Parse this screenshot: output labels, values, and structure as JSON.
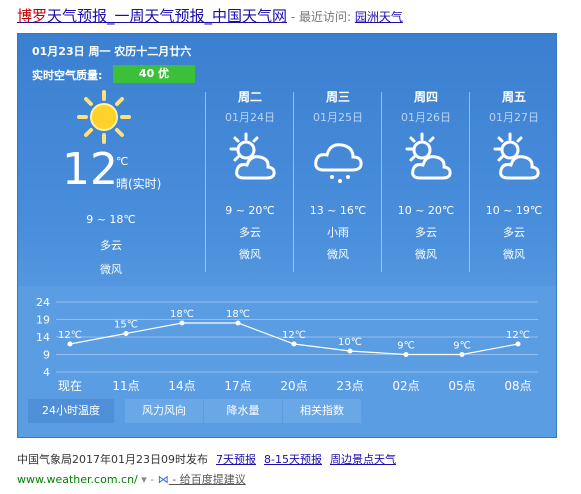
{
  "header": {
    "title_highlight": "博罗",
    "title_rest": "天气预报_一周天气预报_中国天气网",
    "recent_label": " - 最近访问: ",
    "recent_link": "园洲天气"
  },
  "today": {
    "date": "01月23日 周一  农历十二月廿六",
    "aqi_label": "实时空气质量:",
    "aqi_value": "40 优",
    "temp": "12",
    "unit": "℃",
    "note": "晴(实时)",
    "range": "9 ~ 18℃",
    "condition": "多云",
    "wind": "微风",
    "icon": "sun-icon"
  },
  "forecast": [
    {
      "weekday": "周二",
      "date": "01月24日",
      "range": "9 ~ 20℃",
      "condition": "多云",
      "wind": "微风",
      "icon": "partly-cloudy-icon"
    },
    {
      "weekday": "周三",
      "date": "01月25日",
      "range": "13 ~ 16℃",
      "condition": "小雨",
      "wind": "微风",
      "icon": "light-rain-icon"
    },
    {
      "weekday": "周四",
      "date": "01月26日",
      "range": "10 ~ 20℃",
      "condition": "多云",
      "wind": "微风",
      "icon": "partly-cloudy-icon"
    },
    {
      "weekday": "周五",
      "date": "01月27日",
      "range": "10 ~ 19℃",
      "condition": "多云",
      "wind": "微风",
      "icon": "partly-cloudy-icon"
    }
  ],
  "chart_data": {
    "type": "line",
    "categories": [
      "现在",
      "11点",
      "14点",
      "17点",
      "20点",
      "23点",
      "02点",
      "05点",
      "08点"
    ],
    "values": [
      12,
      15,
      18,
      18,
      12,
      10,
      9,
      9,
      12
    ],
    "point_labels": [
      "12℃",
      "15℃",
      "18℃",
      "18℃",
      "12℃",
      "10℃",
      "9℃",
      "9℃",
      "12℃"
    ],
    "y_ticks": [
      "24",
      "19",
      "14",
      "9",
      "4"
    ],
    "ylim": [
      4,
      24
    ],
    "grid": true
  },
  "tabs": [
    "24小时温度",
    "风力风向",
    "降水量",
    "相关指数"
  ],
  "footer": {
    "publish": "中国气象局2017年01月23日09时发布",
    "links": [
      "7天预报",
      "8-15天预报",
      "周边景点天气"
    ],
    "url": "www.weather.com.cn/",
    "sep": " ▾ - ",
    "suggest": " - 给百度提建议"
  },
  "colors": {
    "panel": "#4a8fdc",
    "aqi_good": "#3cc03c"
  }
}
